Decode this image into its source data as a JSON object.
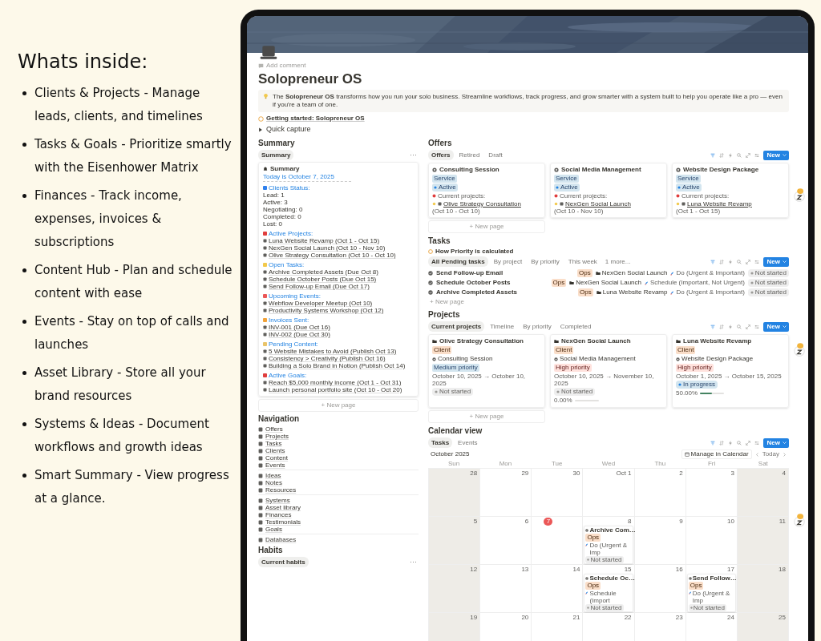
{
  "intro": {
    "heading": "Whats inside:",
    "bullets": [
      "Clients & Projects - Manage leads, clients, and timelines",
      "Tasks & Goals - Prioritize smartly with the Eisenhower Matrix",
      "Finances - Track income, expenses, invoices & subscriptions",
      "Content Hub - Plan and schedule content with ease",
      "Events - Stay on top of calls and launches",
      "Asset Library - Store all your brand resources",
      "Systems & Ideas - Document workflows and growth ideas",
      "Smart Summary - View progress at a glance."
    ]
  },
  "page": {
    "comment": "Add comment",
    "title": "Solopreneur OS",
    "callout": "The **Solopreneur OS** transforms how you run your solo business. Streamline workflows, track progress, and grow smarter with a system built to help you operate like a pro — even if you're a team of one.",
    "getting_started": "Getting started: Solopreneur OS",
    "quick_capture": {
      "label": "Quick capture",
      "expanded": false
    },
    "summary": {
      "heading": "Summary",
      "tabs": [
        {
          "label": "Summary",
          "selected": true
        }
      ],
      "more": "···",
      "card": {
        "title": "Summary",
        "today": "Today is October 7, 2025",
        "sections": [
          {
            "title": "Clients Status:",
            "color": "#2f80ed",
            "kind": "plain",
            "lines": [
              "Lead: 1",
              "Active: 3",
              "Negotiating: 0",
              "Completed: 0",
              "Lost: 0"
            ]
          },
          {
            "title": "Active Projects:",
            "color": "#e03e3e",
            "kind": "links",
            "lines": [
              "Luna Website Revamp (Oct 1 - Oct 15)",
              "NexGen Social Launch (Oct 10 - Nov 10)",
              "Olive Strategy Consultation (Oct 10 - Oct 10)"
            ]
          },
          {
            "title": "Open Tasks:",
            "color": "#f2c94c",
            "kind": "links",
            "lines": [
              "Archive Completed Assets (Due Oct 8)",
              "Schedule October Posts (Due Oct 15)",
              "Send Follow-up Email (Due Oct 17)"
            ]
          },
          {
            "title": "Upcoming Events:",
            "color": "#eb5757",
            "kind": "links",
            "lines": [
              "Webflow Developer Meetup (Oct 10)",
              "Productivity Systems Workshop (Oct 12)"
            ]
          },
          {
            "title": "Invoices Sent:",
            "color": "#f2a33a",
            "kind": "links",
            "lines": [
              "INV-001 (Due Oct 16)",
              "INV-002 (Due Oct 30)"
            ]
          },
          {
            "title": "Pending Content:",
            "color": "#e9c46a",
            "kind": "links",
            "lines": [
              "5 Website Mistakes to Avoid (Publish Oct 13)",
              "Consistency > Creativity (Publish Oct 16)",
              "Building a Solo Brand in Notion (Publish Oct 14)"
            ]
          },
          {
            "title": "Active Goals:",
            "color": "#e03e3e",
            "kind": "links",
            "lines": [
              "Reach $5,000 monthly income (Oct 1 - Oct 31)",
              "Launch personal portfolio site (Oct 10 - Oct 20)"
            ]
          }
        ]
      },
      "new_page": "+ New page"
    },
    "navigation": {
      "heading": "Navigation",
      "groups": [
        [
          "Offers",
          "Projects",
          "Tasks",
          "Clients",
          "Content",
          "Events"
        ],
        [
          "Ideas",
          "Notes",
          "Resources"
        ],
        [
          "Systems",
          "Asset library",
          "Finances",
          "Testimonials",
          "Goals"
        ],
        [
          "Databases"
        ]
      ]
    },
    "habits": {
      "heading": "Habits",
      "tabs": [
        {
          "label": "Current habits",
          "selected": true
        }
      ],
      "more": "···"
    },
    "offers": {
      "heading": "Offers",
      "tabs": [
        {
          "label": "Offers",
          "selected": true
        },
        {
          "label": "Retired",
          "selected": false
        },
        {
          "label": "Draft",
          "selected": false
        }
      ],
      "new_button": "New",
      "cards": [
        {
          "title": "Consulting Session",
          "tag": "Service",
          "status": "Active",
          "projects_label": "Current projects:",
          "project": "Olive Strategy Consultation",
          "project_dates": "(Oct 10 - Oct 10)"
        },
        {
          "title": "Social Media Management",
          "tag": "Service",
          "status": "Active",
          "projects_label": "Current projects:",
          "project": "NexGen Social Launch",
          "project_dates": "(Oct 10 - Nov 10)"
        },
        {
          "title": "Website Design Package",
          "tag": "Service",
          "status": "Active",
          "projects_label": "Current projects:",
          "project": "Luna Website Revamp",
          "project_dates": "(Oct 1 - Oct 15)"
        }
      ],
      "new_page": "+ New page"
    },
    "tasks": {
      "heading": "Tasks",
      "note": "How Priority is calculated",
      "tabs": [
        {
          "label": "All Pending tasks",
          "selected": true
        },
        {
          "label": "By project",
          "selected": false
        },
        {
          "label": "By priority",
          "selected": false
        },
        {
          "label": "This week",
          "selected": false
        }
      ],
      "more": "1 more...",
      "new_button": "New",
      "rows": [
        {
          "name": "Send Follow-up Email",
          "tag": "Ops",
          "project": "NexGen Social Launch",
          "priority": "Do (Urgent & Important)",
          "status": "Not started"
        },
        {
          "name": "Schedule October Posts",
          "tag": "Ops",
          "project": "NexGen Social Launch",
          "priority": "Schedule (Important, Not Urgent)",
          "status": "Not started"
        },
        {
          "name": "Archive Completed Assets",
          "tag": "Ops",
          "project": "Luna Website Revamp",
          "priority": "Do (Urgent & Important)",
          "status": "Not started"
        }
      ],
      "new_page": "+ New page"
    },
    "projects": {
      "heading": "Projects",
      "tabs": [
        {
          "label": "Current projects",
          "selected": true
        },
        {
          "label": "Timeline",
          "selected": false
        },
        {
          "label": "By priority",
          "selected": false
        },
        {
          "label": "Completed",
          "selected": false
        }
      ],
      "new_button": "New",
      "cards": [
        {
          "title": "Olive Strategy Consultation",
          "tag": "Client",
          "offer": "Consulting Session",
          "priority": {
            "label": "Medium priority",
            "kind": "medium"
          },
          "dates": "October 10, 2025 → October 10, 2025",
          "status": {
            "label": "Not started",
            "kind": "not_started"
          }
        },
        {
          "title": "NexGen Social Launch",
          "tag": "Client",
          "offer": "Social Media Management",
          "priority": {
            "label": "High priority",
            "kind": "high"
          },
          "dates": "October 10, 2025 → November 10, 2025",
          "status": {
            "label": "Not started",
            "kind": "not_started"
          },
          "progress": {
            "reading": "0.00%",
            "level": 0
          }
        },
        {
          "title": "Luna Website Revamp",
          "tag": "Client",
          "offer": "Website Design Package",
          "priority": {
            "label": "High priority",
            "kind": "high"
          },
          "dates": "October 1, 2025 → October 15, 2025",
          "status": {
            "label": "In progress",
            "kind": "in_progress"
          },
          "progress": {
            "reading": "50.00%",
            "level": 0.5
          }
        }
      ],
      "new_page": "+ New page"
    },
    "calendar": {
      "heading": "Calendar view",
      "tabs": [
        {
          "label": "Tasks",
          "selected": true
        },
        {
          "label": "Events",
          "selected": false
        }
      ],
      "new_button": "New",
      "month": "October 2025",
      "manage": "Manage in Calendar",
      "today_button": "Today",
      "weekdays": [
        {
          "label": "Sun",
          "shaded": true
        },
        {
          "label": "Mon",
          "shaded": false
        },
        {
          "label": "Tue",
          "shaded": false
        },
        {
          "label": "Wed",
          "shaded": false
        },
        {
          "label": "Thu",
          "shaded": false
        },
        {
          "label": "Fri",
          "shaded": false
        },
        {
          "label": "Sat",
          "shaded": true
        }
      ],
      "weeks": [
        [
          {
            "day": "28",
            "today": false
          },
          {
            "day": "29",
            "today": false
          },
          {
            "day": "30",
            "today": false
          },
          {
            "day": "Oct 1",
            "today": false
          },
          {
            "day": "2",
            "today": false
          },
          {
            "day": "3",
            "today": false
          },
          {
            "day": "4",
            "today": false
          }
        ],
        [
          {
            "day": "5",
            "today": false
          },
          {
            "day": "6",
            "today": false
          },
          {
            "day": "7",
            "today": true
          },
          {
            "day": "8",
            "today": false,
            "events": [
              {
                "title": "Archive Com…",
                "tag": "Ops",
                "priority": "Do (Urgent & Imp",
                "status": "Not started"
              }
            ]
          },
          {
            "day": "9",
            "today": false
          },
          {
            "day": "10",
            "today": false
          },
          {
            "day": "11",
            "today": false
          }
        ],
        [
          {
            "day": "12",
            "today": false
          },
          {
            "day": "13",
            "today": false
          },
          {
            "day": "14",
            "today": false
          },
          {
            "day": "15",
            "today": false,
            "events": [
              {
                "title": "Schedule Oc…",
                "tag": "Ops",
                "priority": "Schedule (Import",
                "status": "Not started"
              }
            ]
          },
          {
            "day": "16",
            "today": false
          },
          {
            "day": "17",
            "today": false,
            "events": [
              {
                "title": "Send Follow…",
                "tag": "Ops",
                "priority": "Do (Urgent & Imp",
                "status": "Not started"
              }
            ]
          },
          {
            "day": "18",
            "today": false
          }
        ],
        [
          {
            "day": "19",
            "today": false
          },
          {
            "day": "20",
            "today": false
          },
          {
            "day": "21",
            "today": false
          },
          {
            "day": "22",
            "today": false
          },
          {
            "day": "23",
            "today": false
          },
          {
            "day": "24",
            "today": false
          },
          {
            "day": "25",
            "today": false
          }
        ]
      ]
    }
  }
}
